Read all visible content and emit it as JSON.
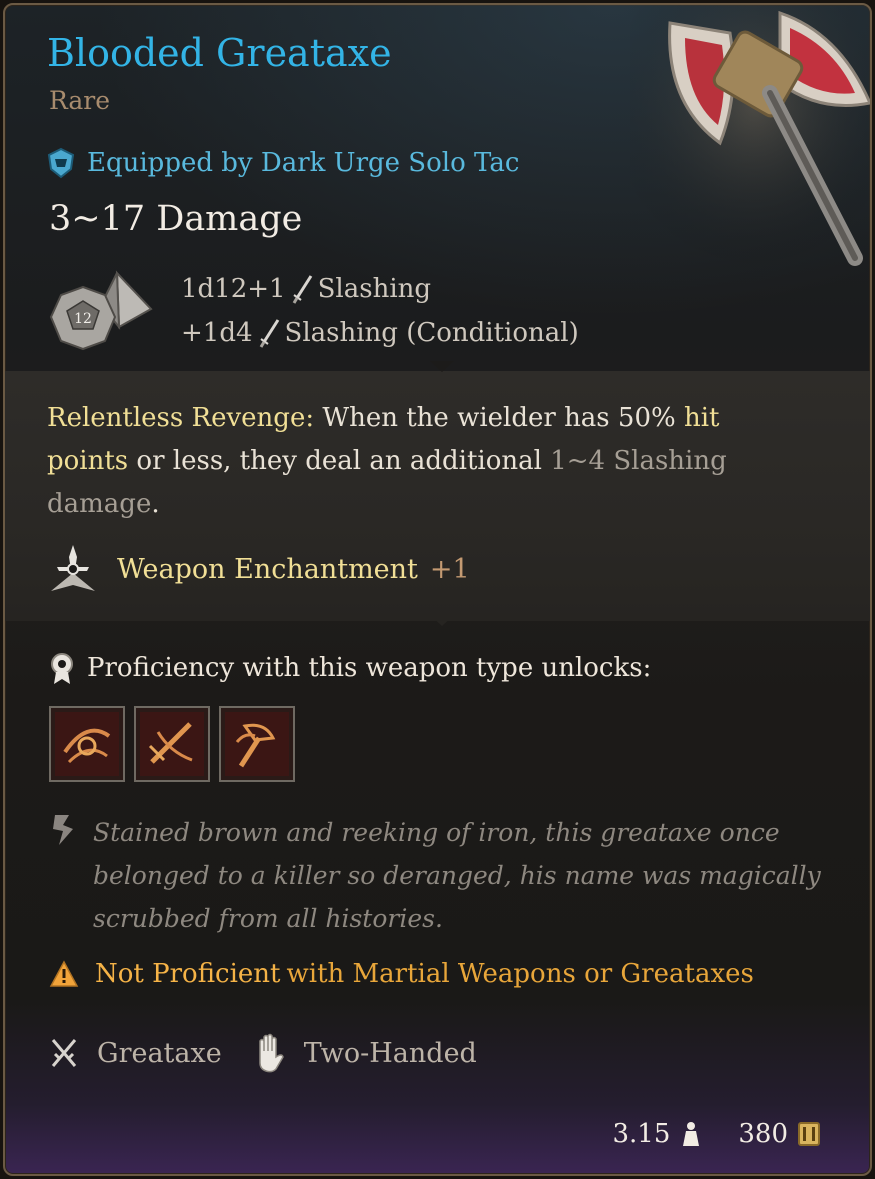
{
  "item": {
    "name": "Blooded Greataxe",
    "rarity": "Rare",
    "equipped_by": "Equipped by Dark Urge Solo Tac",
    "damage_total": "3~17 Damage"
  },
  "damage": {
    "die_face": "12",
    "lines": [
      {
        "dice": "1d12+1",
        "type": "Slashing"
      },
      {
        "dice": "+1d4",
        "type": "Slashing (Conditional)"
      }
    ]
  },
  "passive": {
    "name": "Relentless Revenge:",
    "text_a": " When the wielder has 50% ",
    "hl_a": "hit points",
    "text_b": " or less, they deal an additional ",
    "muted_a": "1~4 Slashing damage",
    "text_c": "."
  },
  "enchantment": {
    "label": "Weapon Enchantment",
    "bonus": "+1"
  },
  "proficiency": {
    "text": "Proficiency with this weapon type unlocks:",
    "actions": [
      "cleave-action-icon",
      "lacerate-action-icon",
      "heartstopper-action-icon"
    ]
  },
  "lore": "Stained brown and reeking of iron, this greataxe once belonged to a killer so deranged, his name was magically scrubbed from all histories.",
  "warning": {
    "strong": "Not Proficient",
    "rest": "with Martial Weapons or Greataxes"
  },
  "tags": {
    "weapon_type": "Greataxe",
    "handedness": "Two-Handed"
  },
  "footer": {
    "weight": "3.15",
    "value": "380"
  },
  "colors": {
    "title": "#33b4e6",
    "equip": "#59b9dd",
    "highlight": "#f1df96",
    "warning": "#f5b347"
  }
}
